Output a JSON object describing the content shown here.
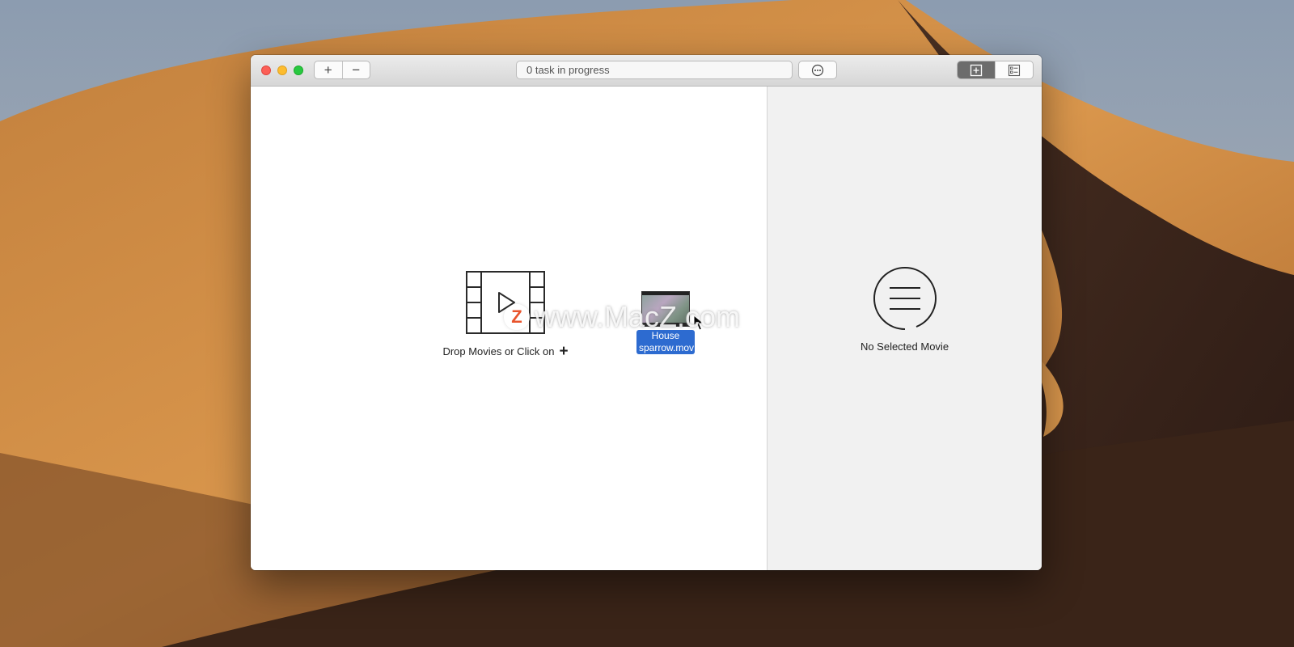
{
  "toolbar": {
    "add_label": "+",
    "remove_label": "−",
    "status_text": "0 task in progress",
    "more_icon": "ellipsis-circle-icon",
    "view_add_icon": "plus-square-icon",
    "view_list_icon": "checklist-icon"
  },
  "main": {
    "drop_hint": "Drop Movies or Click on",
    "drop_icon": "film-play-icon",
    "plus_glyph": "+"
  },
  "drag_item": {
    "line1": "House",
    "line2": "sparrow.mov"
  },
  "sidebar": {
    "empty_icon": "list-circle-icon",
    "empty_text": "No Selected Movie"
  },
  "watermark": {
    "badge": "Z",
    "text": "www.MacZ.com"
  },
  "colors": {
    "close": "#fc5f57",
    "minimize": "#fdbc2e",
    "zoom": "#28c840",
    "selection": "#2d6bd0",
    "sidebar_bg": "#f1f1f1",
    "active_segment": "#6c6c6c"
  }
}
